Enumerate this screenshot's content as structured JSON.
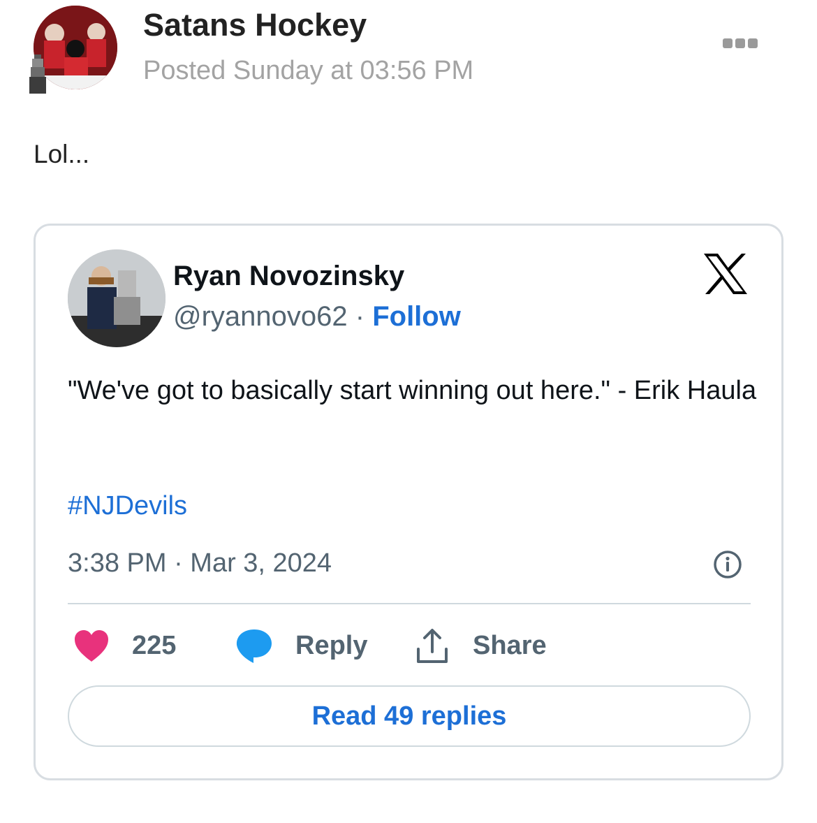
{
  "post": {
    "author": "Satans Hockey",
    "posted": "Posted Sunday at 03:56 PM",
    "text": "Lol..."
  },
  "embed": {
    "name": "Ryan Novozinsky",
    "handle": "@ryannovo62",
    "separator": " · ",
    "follow": "Follow",
    "text": "\"We've got to basically start winning out here.\" - Erik Haula",
    "hashtag": "#NJDevils",
    "timestamp": "3:38 PM · Mar 3, 2024",
    "likes": "225",
    "reply": "Reply",
    "share": "Share",
    "read_replies": "Read 49 replies"
  },
  "colors": {
    "like": "#e8327c",
    "reply": "#1d9bf0",
    "link": "#1d6fd6"
  },
  "icons": [
    "trophy-icon",
    "more-icon",
    "x-logo-icon",
    "info-icon",
    "heart-icon",
    "comment-icon",
    "share-icon"
  ]
}
